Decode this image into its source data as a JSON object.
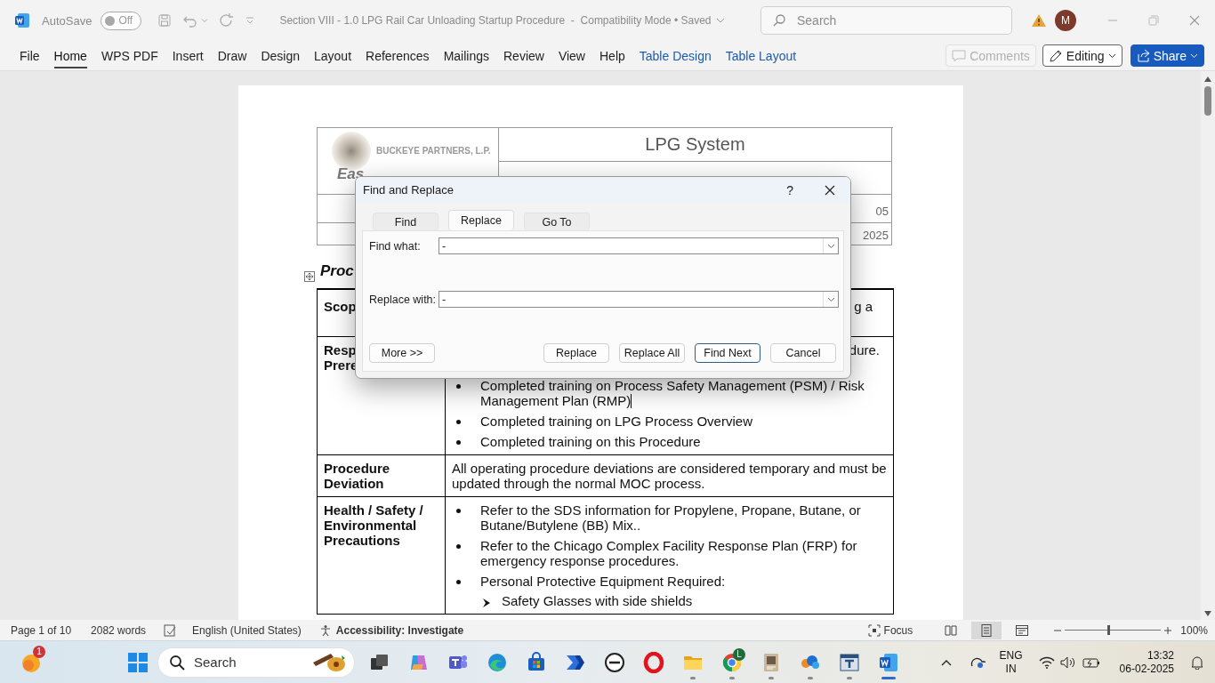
{
  "titlebar": {
    "autosave": {
      "label": "AutoSave",
      "on": false,
      "state_text": "Off"
    },
    "title": "Section VIII - 1.0 LPG Rail Car Unloading Startup Procedure  -  Compatibility Mode • Saved",
    "search": {
      "placeholder": "Search"
    },
    "avatar": "M"
  },
  "ribbon": {
    "tabs": [
      {
        "label": "File",
        "selected": false,
        "contextual": false
      },
      {
        "label": "Home",
        "selected": true,
        "contextual": false
      },
      {
        "label": "WPS PDF",
        "selected": false,
        "contextual": false
      },
      {
        "label": "Insert",
        "selected": false,
        "contextual": false
      },
      {
        "label": "Draw",
        "selected": false,
        "contextual": false
      },
      {
        "label": "Design",
        "selected": false,
        "contextual": false
      },
      {
        "label": "Layout",
        "selected": false,
        "contextual": false
      },
      {
        "label": "References",
        "selected": false,
        "contextual": false
      },
      {
        "label": "Mailings",
        "selected": false,
        "contextual": false
      },
      {
        "label": "Review",
        "selected": false,
        "contextual": false
      },
      {
        "label": "View",
        "selected": false,
        "contextual": false
      },
      {
        "label": "Help",
        "selected": false,
        "contextual": false
      },
      {
        "label": "Table Design",
        "selected": false,
        "contextual": true
      },
      {
        "label": "Table Layout",
        "selected": false,
        "contextual": true
      }
    ],
    "comments": {
      "label": "Comments",
      "disabled": true
    },
    "editing": "Editing",
    "share": "Share"
  },
  "document": {
    "header_table": {
      "company": "BUCKEYE PARTNERS, L.P.",
      "company_line_2": "Eas",
      "system": "LPG System",
      "row_3": "05",
      "row_4": "2025"
    },
    "heading": "Proc",
    "rows": [
      {
        "label_lines": [
          "Scop"
        ],
        "lead": "g a"
      },
      {
        "label_lines": [
          "Resp",
          "Prere"
        ],
        "lead": "dure.",
        "bullets": [
          {
            "text": "Completed training on Process Safety Management (PSM) / Risk Management Plan (RMP)",
            "caret_after": true
          },
          {
            "text": "Completed training on LPG Process Overview",
            "caret_after": false
          },
          {
            "text": "Completed training on this Procedure",
            "caret_after": false
          }
        ]
      },
      {
        "label_lines": [
          "Procedure",
          "Deviation"
        ],
        "paragraph": "All operating procedure deviations are considered temporary and must be updated through the normal MOC process."
      },
      {
        "label_lines": [
          "Health / Safety /",
          "Environmental",
          "Precautions"
        ],
        "bullets": [
          {
            "text": "Refer to the SDS information for Propylene, Propane, Butane, or Butane/Butylene (BB) Mix..",
            "caret_after": false
          },
          {
            "text": "Refer to the Chicago Complex Facility Response Plan (FRP) for emergency response procedures.",
            "caret_after": false
          },
          {
            "text": "Personal Protective Equipment Required:",
            "caret_after": false,
            "children": [
              {
                "text": "Safety Glasses with side shields"
              }
            ]
          }
        ]
      }
    ]
  },
  "dialog": {
    "title": "Find and Replace",
    "help": "?",
    "tabs": [
      {
        "label": "Find",
        "selected": false
      },
      {
        "label": "Replace",
        "selected": true
      },
      {
        "label": "Go To",
        "selected": false
      }
    ],
    "fields": [
      {
        "label": "Find what:",
        "value": "-"
      },
      {
        "label": "Replace with:",
        "value": "-"
      }
    ],
    "more_button": "More >>",
    "buttons": [
      {
        "label": "Replace",
        "default": false
      },
      {
        "label": "Replace All",
        "default": false
      },
      {
        "label": "Find Next",
        "default": true
      },
      {
        "label": "Cancel",
        "default": false
      }
    ]
  },
  "status_bar": {
    "page": "Page 1 of 10",
    "words": "2082 words",
    "language": "English (United States)",
    "accessibility": "Accessibility: Investigate",
    "focus": "Focus",
    "views": [
      {
        "kind": "read",
        "selected": false
      },
      {
        "kind": "print",
        "selected": true
      },
      {
        "kind": "web",
        "selected": false
      }
    ],
    "zoom": {
      "level": 0.45,
      "reading": "100%"
    }
  },
  "taskbar": {
    "widgets_badge": "1",
    "search_placeholder": "Search",
    "apps": [
      {
        "kind": "taskview",
        "running": false
      },
      {
        "kind": "copilot",
        "running": false
      },
      {
        "kind": "teams",
        "running": false
      },
      {
        "kind": "edge",
        "running": false
      },
      {
        "kind": "store",
        "running": false
      },
      {
        "kind": "automate",
        "running": false
      },
      {
        "kind": "dell",
        "running": false
      },
      {
        "kind": "opera",
        "running": false
      },
      {
        "kind": "folder",
        "running": true
      },
      {
        "kind": "chrome",
        "running": true,
        "badge": "L"
      },
      {
        "kind": "doc",
        "running": true
      },
      {
        "kind": "cloud",
        "running": true
      },
      {
        "kind": "window",
        "running": true
      },
      {
        "kind": "word",
        "running": true
      }
    ],
    "tray": {
      "language": "ENG",
      "region": "IN",
      "time": "13:32",
      "date": "06-02-2025"
    }
  }
}
